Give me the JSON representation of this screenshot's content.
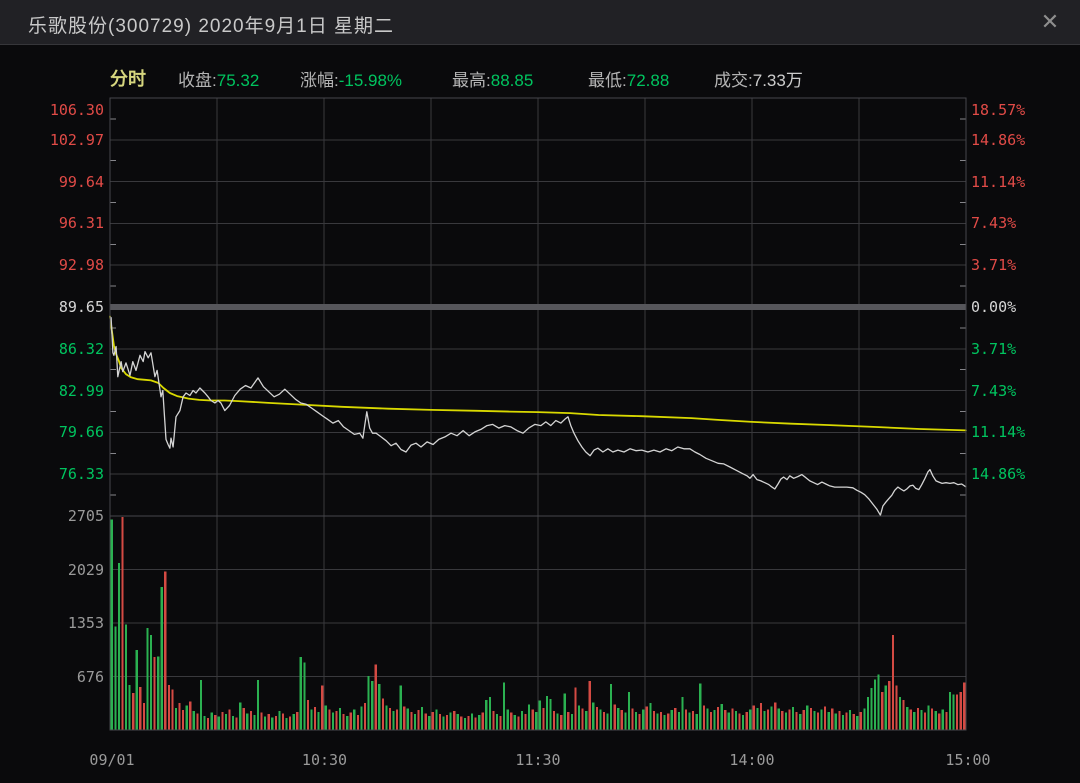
{
  "window": {
    "title": "乐歌股份(300729)  2020年9月1日  星期二",
    "close_icon": "✕"
  },
  "info_bar": {
    "mode": "分时",
    "stats": [
      {
        "name": "stat-close",
        "label": "收盘:",
        "value": "75.32",
        "tone": "down"
      },
      {
        "name": "stat-change",
        "label": "涨幅:",
        "value": "-15.98%",
        "tone": "down"
      },
      {
        "name": "stat-high",
        "label": "最高:",
        "value": "88.85",
        "tone": "down"
      },
      {
        "name": "stat-low",
        "label": "最低:",
        "value": "72.88",
        "tone": "down"
      },
      {
        "name": "stat-volume",
        "label": "成交:",
        "value": "7.33万",
        "tone": "plain"
      }
    ]
  },
  "colors": {
    "up": "#e14b47",
    "down": "#00c45f",
    "flat": "#d6d6d6",
    "price_line": "#d4d4d4",
    "avg_line": "#d9d900",
    "vol_up": "#d44a43",
    "vol_down": "#2bb151",
    "grid": "#39393d",
    "frame": "#47474b",
    "zero_band": "#56565b",
    "tick": "#85858a",
    "dim_text": "#9a9a9a"
  },
  "chart_data": {
    "type": "line",
    "title": "乐歌股份(300729) 分时走势 2020-09-01",
    "prev_close": 89.65,
    "summary": {
      "close": 75.32,
      "change_pct": -15.98,
      "high": 88.85,
      "low": 72.88,
      "volume": "7.33万"
    },
    "y_axis_left_prices": [
      {
        "t": "106.30",
        "tone": "up"
      },
      {
        "t": "102.97",
        "tone": "up"
      },
      {
        "t": "99.64",
        "tone": "up"
      },
      {
        "t": "96.31",
        "tone": "up"
      },
      {
        "t": "92.98",
        "tone": "up"
      },
      {
        "t": "89.65",
        "tone": "flat"
      },
      {
        "t": "86.32",
        "tone": "down"
      },
      {
        "t": "82.99",
        "tone": "down"
      },
      {
        "t": "79.66",
        "tone": "down"
      },
      {
        "t": "76.33",
        "tone": "down"
      }
    ],
    "y_axis_right_percents": [
      {
        "t": "18.57%",
        "tone": "up"
      },
      {
        "t": "14.86%",
        "tone": "up"
      },
      {
        "t": "11.14%",
        "tone": "up"
      },
      {
        "t": "7.43%",
        "tone": "up"
      },
      {
        "t": "3.71%",
        "tone": "up"
      },
      {
        "t": "0.00%",
        "tone": "flat"
      },
      {
        "t": "3.71%",
        "tone": "down"
      },
      {
        "t": "7.43%",
        "tone": "down"
      },
      {
        "t": "11.14%",
        "tone": "down"
      },
      {
        "t": "14.86%",
        "tone": "down"
      }
    ],
    "volume_axis": [
      "2705",
      "2029",
      "1353",
      "676"
    ],
    "x_axis": [
      "09/01",
      "10:30",
      "11:30",
      "14:00",
      "15:00"
    ],
    "x_range_minutes": [
      0,
      240
    ],
    "price_pct_step": 3.714,
    "price_line": [
      [
        0,
        88.85
      ],
      [
        0.3,
        88.8
      ],
      [
        0.8,
        86.0
      ],
      [
        1.1,
        85.8
      ],
      [
        1.7,
        86.5
      ],
      [
        2.2,
        84.1
      ],
      [
        3.1,
        85.3
      ],
      [
        3.6,
        84.5
      ],
      [
        4.5,
        85.2
      ],
      [
        5.6,
        84.2
      ],
      [
        6.4,
        85.3
      ],
      [
        7.3,
        84.6
      ],
      [
        8.4,
        85.8
      ],
      [
        9.3,
        85.3
      ],
      [
        9.8,
        86.1
      ],
      [
        10.7,
        85.6
      ],
      [
        11.5,
        86.0
      ],
      [
        12.6,
        84.1
      ],
      [
        13.2,
        84.6
      ],
      [
        14.3,
        82.5
      ],
      [
        14.8,
        83.0
      ],
      [
        15.7,
        79.1
      ],
      [
        16.3,
        78.7
      ],
      [
        16.8,
        78.4
      ],
      [
        17.1,
        79.2
      ],
      [
        17.7,
        78.5
      ],
      [
        18.5,
        80.9
      ],
      [
        19.6,
        81.4
      ],
      [
        20.5,
        82.5
      ],
      [
        21.3,
        82.8
      ],
      [
        22.4,
        82.6
      ],
      [
        23.3,
        83.0
      ],
      [
        24.1,
        82.8
      ],
      [
        25.2,
        83.2
      ],
      [
        26.6,
        82.8
      ],
      [
        27.5,
        82.5
      ],
      [
        28.3,
        82.2
      ],
      [
        29.4,
        82.0
      ],
      [
        30.3,
        82.2
      ],
      [
        31.1,
        82.0
      ],
      [
        32.2,
        81.4
      ],
      [
        33.5,
        81.8
      ],
      [
        35,
        82.6
      ],
      [
        36.5,
        83.1
      ],
      [
        38,
        83.4
      ],
      [
        39.5,
        83.2
      ],
      [
        41.5,
        84.0
      ],
      [
        43,
        83.3
      ],
      [
        44.5,
        82.9
      ],
      [
        46,
        82.5
      ],
      [
        47.5,
        82.7
      ],
      [
        49,
        83.1
      ],
      [
        50.5,
        82.7
      ],
      [
        52,
        82.3
      ],
      [
        53.5,
        82.0
      ],
      [
        55,
        81.9
      ],
      [
        56.5,
        81.6
      ],
      [
        58,
        81.3
      ],
      [
        59.5,
        81.0
      ],
      [
        61,
        80.7
      ],
      [
        62.5,
        80.4
      ],
      [
        64,
        80.6
      ],
      [
        65.5,
        80.1
      ],
      [
        67,
        79.8
      ],
      [
        68.5,
        79.5
      ],
      [
        70,
        79.6
      ],
      [
        70.9,
        79.2
      ],
      [
        71.4,
        80.2
      ],
      [
        72,
        81.3
      ],
      [
        72.8,
        80.0
      ],
      [
        73.6,
        79.6
      ],
      [
        74.6,
        79.6
      ],
      [
        76,
        79.3
      ],
      [
        77.4,
        79.0
      ],
      [
        78.8,
        78.6
      ],
      [
        80.2,
        78.8
      ],
      [
        81.6,
        78.3
      ],
      [
        83,
        78.1
      ],
      [
        84.4,
        78.65
      ],
      [
        85.8,
        78.8
      ],
      [
        87.2,
        78.5
      ],
      [
        88.9,
        78.9
      ],
      [
        90.6,
        78.7
      ],
      [
        92.2,
        79.1
      ],
      [
        93.9,
        79.3
      ],
      [
        95.6,
        79.6
      ],
      [
        97.3,
        79.4
      ],
      [
        99,
        79.8
      ],
      [
        100.7,
        79.4
      ],
      [
        102.3,
        79.7
      ],
      [
        104,
        79.9
      ],
      [
        105.7,
        80.2
      ],
      [
        107.3,
        80.3
      ],
      [
        109,
        80.0
      ],
      [
        110.7,
        80.2
      ],
      [
        112.4,
        80.1
      ],
      [
        114.1,
        79.8
      ],
      [
        115.8,
        79.6
      ],
      [
        117.4,
        80.0
      ],
      [
        119.1,
        80.3
      ],
      [
        120.8,
        80.2
      ],
      [
        122.2,
        80.5
      ],
      [
        123.6,
        80.2
      ],
      [
        125,
        80.6
      ],
      [
        126.4,
        80.4
      ],
      [
        127.5,
        80.7
      ],
      [
        128.4,
        80.9
      ],
      [
        129.2,
        80.2
      ],
      [
        130.1,
        79.6
      ],
      [
        131.2,
        79.0
      ],
      [
        132.3,
        78.5
      ],
      [
        133.4,
        78.1
      ],
      [
        134.6,
        77.8
      ],
      [
        135.7,
        78.25
      ],
      [
        136.8,
        78.4
      ],
      [
        138.2,
        78.1
      ],
      [
        139.6,
        78.35
      ],
      [
        141,
        78.1
      ],
      [
        142.4,
        78.25
      ],
      [
        144.1,
        78.1
      ],
      [
        145.8,
        78.35
      ],
      [
        147.5,
        78.2
      ],
      [
        149.1,
        78.25
      ],
      [
        150.8,
        78.1
      ],
      [
        152.5,
        78.25
      ],
      [
        154.2,
        78.1
      ],
      [
        155.9,
        78.35
      ],
      [
        157.5,
        78.2
      ],
      [
        159.2,
        78.5
      ],
      [
        160.9,
        78.35
      ],
      [
        162.6,
        78.35
      ],
      [
        164,
        78.1
      ],
      [
        165.4,
        77.9
      ],
      [
        167.1,
        77.6
      ],
      [
        168.8,
        77.4
      ],
      [
        170.5,
        77.2
      ],
      [
        172.1,
        77.15
      ],
      [
        173.8,
        76.9
      ],
      [
        175.5,
        76.65
      ],
      [
        177.2,
        76.4
      ],
      [
        178.6,
        76.2
      ],
      [
        179.4,
        76.0
      ],
      [
        180.3,
        76.3
      ],
      [
        181.4,
        75.9
      ],
      [
        182.5,
        75.8
      ],
      [
        183.6,
        75.65
      ],
      [
        184.7,
        75.5
      ],
      [
        185.6,
        75.3
      ],
      [
        186.4,
        75.15
      ],
      [
        187.3,
        75.55
      ],
      [
        188.1,
        75.95
      ],
      [
        188.9,
        76.1
      ],
      [
        189.8,
        75.9
      ],
      [
        190.6,
        76.2
      ],
      [
        191.7,
        76.0
      ],
      [
        192.9,
        76.15
      ],
      [
        194,
        76.3
      ],
      [
        195.1,
        76.05
      ],
      [
        196.2,
        75.8
      ],
      [
        197.3,
        75.65
      ],
      [
        198.4,
        75.5
      ],
      [
        199.6,
        75.7
      ],
      [
        200.7,
        75.55
      ],
      [
        201.8,
        75.4
      ],
      [
        203.2,
        75.3
      ],
      [
        204.9,
        75.3
      ],
      [
        206.6,
        75.3
      ],
      [
        208.3,
        75.25
      ],
      [
        209.4,
        75.05
      ],
      [
        210.5,
        74.9
      ],
      [
        211.6,
        74.7
      ],
      [
        212.8,
        74.35
      ],
      [
        213.9,
        73.95
      ],
      [
        215,
        73.55
      ],
      [
        216,
        72.88
      ],
      [
        216.7,
        73.8
      ],
      [
        217.5,
        74.1
      ],
      [
        218.4,
        74.4
      ],
      [
        219.2,
        74.65
      ],
      [
        220,
        75.05
      ],
      [
        220.9,
        75.3
      ],
      [
        221.7,
        75.15
      ],
      [
        222.6,
        75.0
      ],
      [
        223.4,
        75.15
      ],
      [
        224.3,
        75.4
      ],
      [
        225.1,
        75.45
      ],
      [
        225.9,
        75.2
      ],
      [
        226.8,
        75.1
      ],
      [
        227.6,
        75.5
      ],
      [
        228.5,
        76.0
      ],
      [
        229.3,
        76.5
      ],
      [
        229.9,
        76.7
      ],
      [
        230.7,
        76.2
      ],
      [
        231.6,
        75.8
      ],
      [
        232.4,
        75.7
      ],
      [
        233.3,
        75.6
      ],
      [
        234.4,
        75.65
      ],
      [
        235.5,
        75.6
      ],
      [
        236.6,
        75.65
      ],
      [
        237.7,
        75.5
      ],
      [
        238.8,
        75.55
      ],
      [
        240,
        75.32
      ]
    ],
    "avg_line": [
      [
        0,
        88.9
      ],
      [
        0.5,
        87.8
      ],
      [
        1.1,
        86.6
      ],
      [
        1.7,
        85.9
      ],
      [
        2.5,
        85.35
      ],
      [
        3.1,
        84.8
      ],
      [
        4.5,
        84.3
      ],
      [
        5.9,
        84.05
      ],
      [
        7.8,
        83.9
      ],
      [
        9.8,
        83.85
      ],
      [
        11.5,
        83.8
      ],
      [
        13.5,
        83.6
      ],
      [
        15,
        83.2
      ],
      [
        16.8,
        82.8
      ],
      [
        18.8,
        82.55
      ],
      [
        20.5,
        82.45
      ],
      [
        22,
        82.35
      ],
      [
        25,
        82.25
      ],
      [
        28.3,
        82.2
      ],
      [
        32.2,
        82.2
      ],
      [
        36,
        82.15
      ],
      [
        45,
        82.0
      ],
      [
        55,
        81.85
      ],
      [
        65,
        81.7
      ],
      [
        78,
        81.55
      ],
      [
        90,
        81.45
      ],
      [
        103,
        81.38
      ],
      [
        112,
        81.32
      ],
      [
        120,
        81.28
      ],
      [
        129,
        81.2
      ],
      [
        137,
        81.05
      ],
      [
        149,
        80.95
      ],
      [
        163,
        80.8
      ],
      [
        171,
        80.65
      ],
      [
        180,
        80.5
      ],
      [
        191,
        80.35
      ],
      [
        201,
        80.25
      ],
      [
        214,
        80.1
      ],
      [
        227,
        79.93
      ],
      [
        240,
        79.82
      ]
    ],
    "volume_bars": [
      "g2660",
      "g1310",
      "g2110",
      "r2705",
      "g1330",
      "g570",
      "r470",
      "g1010",
      "r545",
      "r340",
      "g1290",
      "g1200",
      "r920",
      "g930",
      "g1810",
      "r2000",
      "r570",
      "r510",
      "g280",
      "r340",
      "r250",
      "g310",
      "r360",
      "g240",
      "r210",
      "g630",
      "g180",
      "r150",
      "g220",
      "r190",
      "g170",
      "r230",
      "g200",
      "r260",
      "g180",
      "r160",
      "g350",
      "r280",
      "g210",
      "r240",
      "g190",
      "g630",
      "r220",
      "g170",
      "r200",
      "g160",
      "r180",
      "g240",
      "r210",
      "g150",
      "r170",
      "g200",
      "r230",
      "g920",
      "g850",
      "r380",
      "g260",
      "r290",
      "g230",
      "r560",
      "g310",
      "r260",
      "g220",
      "r240",
      "g280",
      "r200",
      "g180",
      "r220",
      "g260",
      "r190",
      "g300",
      "r340",
      "g680",
      "g620",
      "r830",
      "g580",
      "r400",
      "g310",
      "r280",
      "g240",
      "r260",
      "g560",
      "r300",
      "g270",
      "r230",
      "g200",
      "r250",
      "g290",
      "r210",
      "g180",
      "r230",
      "g260",
      "r200",
      "g170",
      "r190",
      "g220",
      "r240",
      "g200",
      "r170",
      "g150",
      "r180",
      "g210",
      "r160",
      "g190",
      "r220",
      "g380",
      "g420",
      "r240",
      "g200",
      "r180",
      "g600",
      "g260",
      "r220",
      "g190",
      "r170",
      "g240",
      "r200",
      "g320",
      "r260",
      "g230",
      "g370",
      "r280",
      "g430",
      "g390",
      "r240",
      "g210",
      "r190",
      "g460",
      "r230",
      "g200",
      "r540",
      "g310",
      "r270",
      "g240",
      "r620",
      "g350",
      "r290",
      "g260",
      "r230",
      "g210",
      "g580",
      "r320",
      "g280",
      "r250",
      "g220",
      "g480",
      "r270",
      "g230",
      "r200",
      "g260",
      "r300",
      "g340",
      "r240",
      "g210",
      "r230",
      "g190",
      "r210",
      "g250",
      "r280",
      "g230",
      "g420",
      "r260",
      "g220",
      "r240",
      "g200",
      "g590",
      "r310",
      "g270",
      "r230",
      "g250",
      "r290",
      "g330",
      "r250",
      "g220",
      "r270",
      "g240",
      "r210",
      "g190",
      "r230",
      "g260",
      "r310",
      "g280",
      "r340",
      "g240",
      "r260",
      "g300",
      "r350",
      "g270",
      "r240",
      "g220",
      "r260",
      "g290",
      "r230",
      "g200",
      "r250",
      "g310",
      "r280",
      "g240",
      "r220",
      "g260",
      "r300",
      "g230",
      "r270",
      "g210",
      "r240",
      "g190",
      "r220",
      "g250",
      "r200",
      "g180",
      "r230",
      "g270",
      "g420",
      "g530",
      "g640",
      "g700",
      "r480",
      "g560",
      "r620",
      "r1200",
      "r560",
      "g420",
      "r380",
      "g290",
      "r260",
      "g230",
      "r280",
      "g250",
      "r220",
      "g310",
      "r270",
      "g240",
      "r210",
      "g260",
      "r230",
      "g480",
      "g450",
      "r450",
      "r480",
      "r600"
    ]
  }
}
